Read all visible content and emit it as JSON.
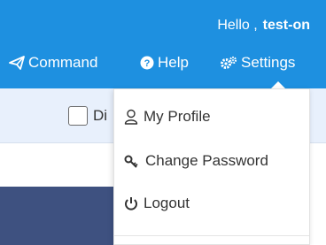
{
  "header": {
    "greeting": "Hello ,",
    "username": "test-on",
    "nav": {
      "command": "Command",
      "help": "Help",
      "settings": "Settings"
    }
  },
  "toolbar": {
    "checkbox_label": "Di"
  },
  "settings_menu": {
    "items": [
      {
        "label": "My Profile",
        "icon": "user-icon"
      },
      {
        "label": "Change Password",
        "icon": "key-icon"
      },
      {
        "label": "Logout",
        "icon": "power-icon"
      }
    ]
  },
  "colors": {
    "header_bg": "#1e90e0",
    "subbar_bg": "#e8f0fc",
    "panel_bg": "#3e5180"
  }
}
